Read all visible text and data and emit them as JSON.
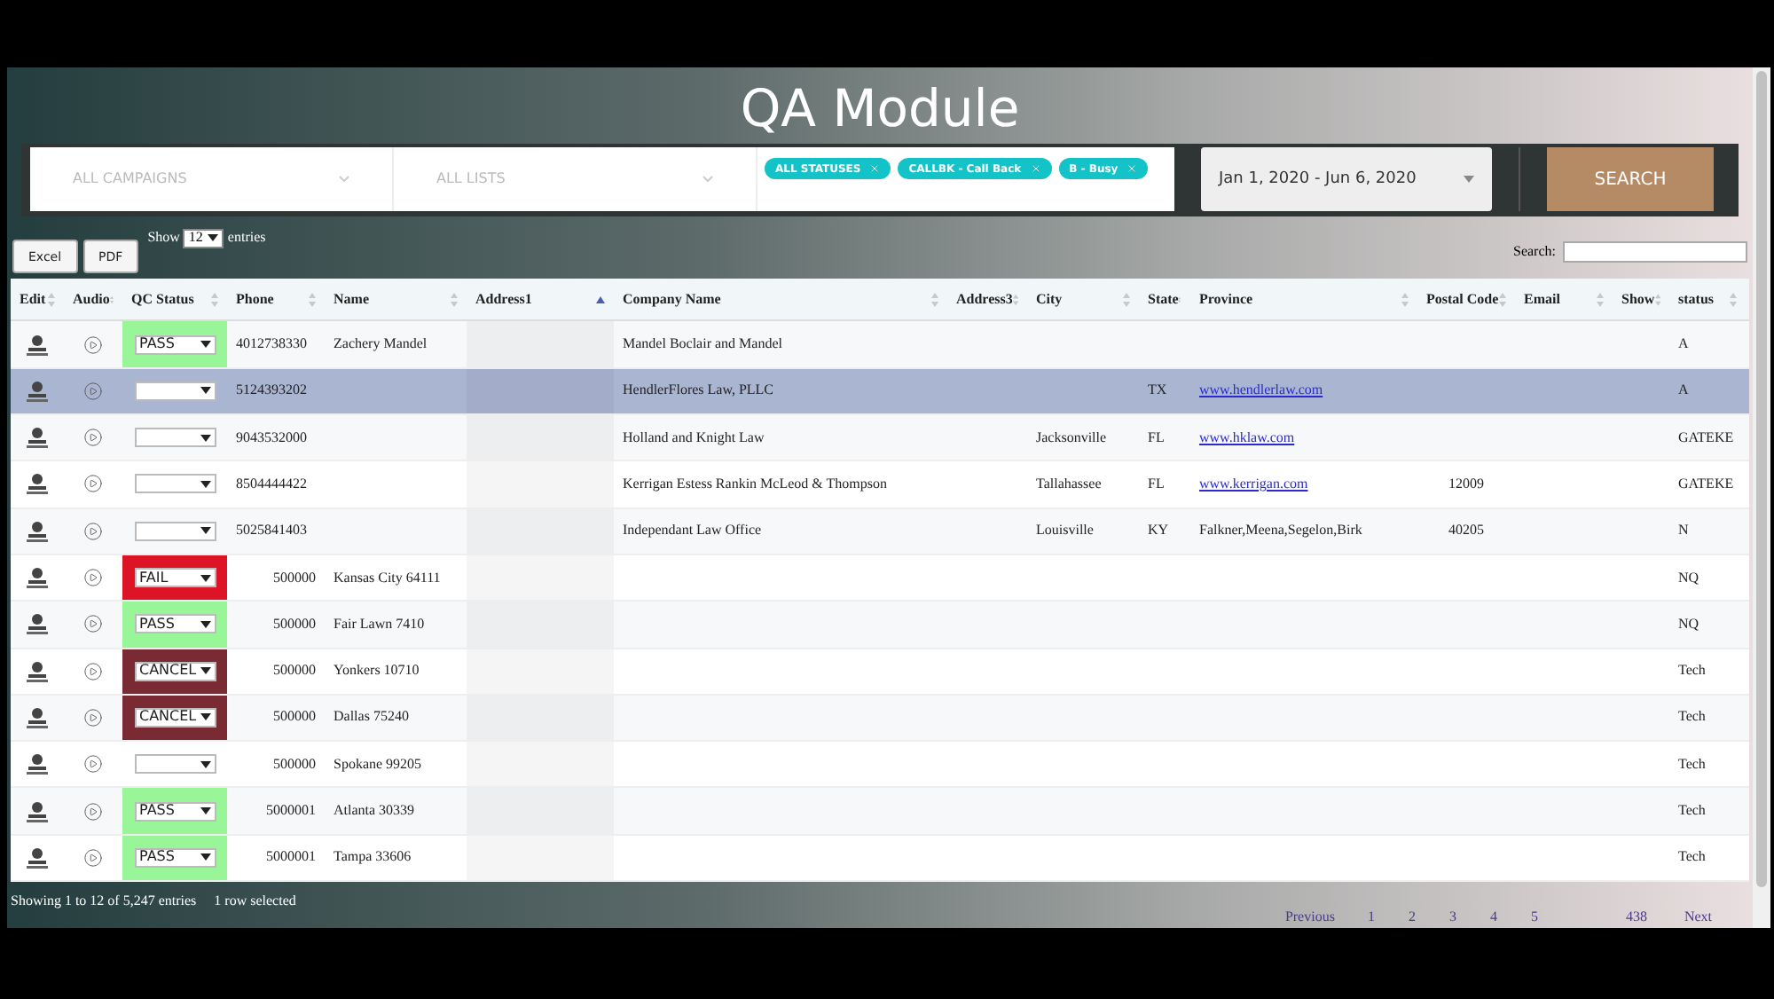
{
  "title": "QA Module",
  "filters": {
    "campaigns": {
      "placeholder": "ALL CAMPAIGNS"
    },
    "lists": {
      "placeholder": "ALL LISTS"
    },
    "tags": [
      "ALL STATUSES",
      "CALLBK - Call Back",
      "B - Busy"
    ],
    "date_range": "Jan 1, 2020 - Jun 6, 2020",
    "search_button": "SEARCH"
  },
  "toolbar": {
    "buttons": [
      "Excel",
      "PDF"
    ],
    "show_label": "Show",
    "page_size": "12",
    "entries_label": "entries",
    "search_label": "Search:"
  },
  "table": {
    "columns": [
      {
        "label": "Edit",
        "sorted": false
      },
      {
        "label": "Audio",
        "sorted": false
      },
      {
        "label": "QC Status",
        "sorted": false
      },
      {
        "label": "Phone",
        "sorted": false
      },
      {
        "label": "Name",
        "sorted": false
      },
      {
        "label": "Address1",
        "sorted": true
      },
      {
        "label": "Company Name",
        "sorted": false
      },
      {
        "label": "Address3",
        "sorted": false
      },
      {
        "label": "City",
        "sorted": false
      },
      {
        "label": "State",
        "sorted": false
      },
      {
        "label": "Province",
        "sorted": false
      },
      {
        "label": "Postal Code",
        "sorted": false
      },
      {
        "label": "Email",
        "sorted": false
      },
      {
        "label": "Show",
        "sorted": false
      },
      {
        "label": "status",
        "sorted": false
      }
    ],
    "rows": [
      {
        "selected": false,
        "kind": "contact",
        "qc": {
          "value": "PASS",
          "color": "#98f598"
        },
        "phone": "4012738330",
        "name": "Zachery Mandel",
        "company": "Mandel Boclair and Mandel",
        "status": "A"
      },
      {
        "selected": true,
        "kind": "contact",
        "qc": {},
        "phone": "5124393202",
        "company": "HendlerFlores Law, PLLC",
        "state": "TX",
        "province": {
          "text": "www.hendlerlaw.com",
          "link": true
        },
        "status": "A"
      },
      {
        "selected": false,
        "kind": "contact",
        "qc": {},
        "phone": "9043532000",
        "company": "Holland and Knight Law",
        "city": "Jacksonville",
        "state": "FL",
        "province": {
          "text": "www.hklaw.com",
          "link": true
        },
        "status": "GATEKE"
      },
      {
        "selected": false,
        "kind": "contact",
        "qc": {},
        "phone": "8504444422",
        "company": "Kerrigan Estess Rankin McLeod & Thompson",
        "city": "Tallahassee",
        "state": "FL",
        "province": {
          "text": "www.kerrigan.com",
          "link": true
        },
        "postal": "12009",
        "status": "GATEKE"
      },
      {
        "selected": false,
        "kind": "contact",
        "qc": {},
        "phone": "5025841403",
        "company": "Independant Law Office",
        "city": "Louisville",
        "state": "KY",
        "province": {
          "text": "Falkner,Meena,Segelon,Birk",
          "link": false
        },
        "postal": "40205",
        "status": "N"
      },
      {
        "selected": false,
        "kind": "test",
        "qc": {
          "value": "FAIL",
          "color": "#dc1426"
        },
        "phone": "500000",
        "name": "Kansas City 64111",
        "status": "NQ"
      },
      {
        "selected": false,
        "kind": "test",
        "qc": {
          "value": "PASS",
          "color": "#98f598"
        },
        "phone": "500000",
        "name": "Fair Lawn 7410",
        "status": "NQ"
      },
      {
        "selected": false,
        "kind": "test",
        "qc": {
          "value": "CANCEL",
          "color": "#7a2a32"
        },
        "phone": "500000",
        "name": "Yonkers 10710",
        "status": "Tech"
      },
      {
        "selected": false,
        "kind": "test",
        "qc": {
          "value": "CANCEL",
          "color": "#7a2a32"
        },
        "phone": "500000",
        "name": "Dallas 75240",
        "status": "Tech"
      },
      {
        "selected": false,
        "kind": "test",
        "qc": {},
        "phone": "500000",
        "name": "Spokane 99205",
        "status": "Tech"
      },
      {
        "selected": false,
        "kind": "test",
        "qc": {
          "value": "PASS",
          "color": "#98f598"
        },
        "phone": "5000001",
        "name": "Atlanta 30339",
        "status": "Tech"
      },
      {
        "selected": false,
        "kind": "test",
        "qc": {
          "value": "PASS",
          "color": "#98f598"
        },
        "phone": "5000001",
        "name": "Tampa 33606",
        "status": "Tech"
      }
    ]
  },
  "footer": {
    "info": "Showing 1 to 12 of 5,247 entries",
    "selection": "1 row selected",
    "pagination": [
      {
        "label": "Previous",
        "kind": "nav"
      },
      {
        "label": "1",
        "kind": "page"
      },
      {
        "label": "2",
        "kind": "page"
      },
      {
        "label": "3",
        "kind": "page"
      },
      {
        "label": "4",
        "kind": "page"
      },
      {
        "label": "5",
        "kind": "page"
      },
      {
        "label": "438",
        "kind": "last"
      },
      {
        "label": "Next",
        "kind": "nav"
      }
    ]
  }
}
